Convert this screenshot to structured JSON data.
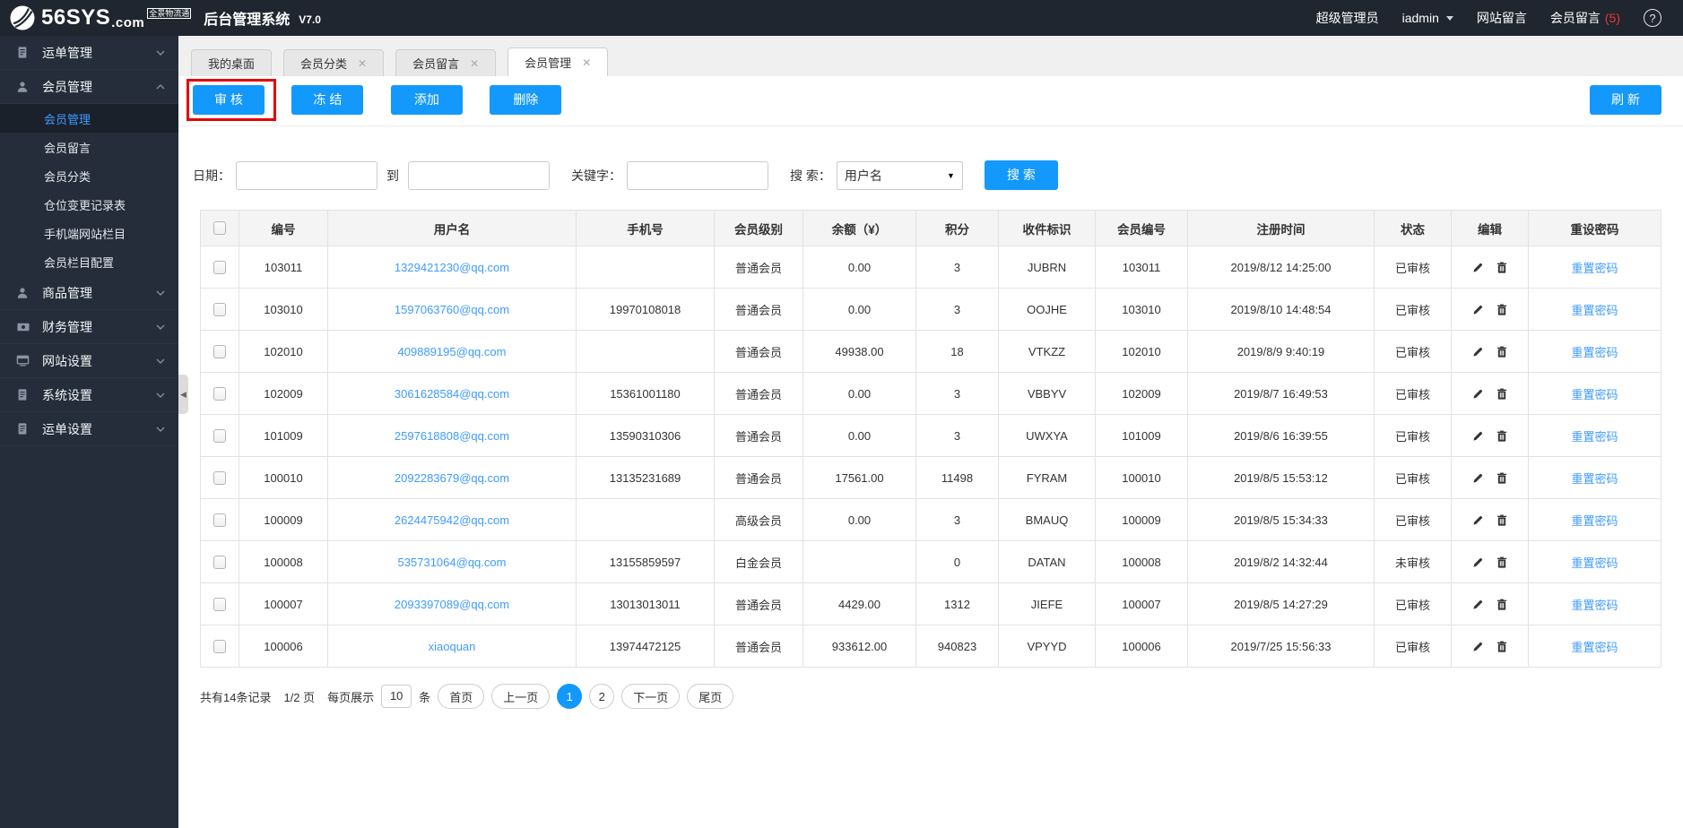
{
  "app": {
    "brand": "56SYS",
    "brand_suffix": ".com",
    "brand_tagline": "全景物流通",
    "title": "后台管理系统",
    "version": "V7.0",
    "topbar": {
      "role": "超级管理员",
      "username": "iadmin",
      "site_messages": "网站留言",
      "member_messages": "会员留言",
      "member_messages_count": "(5)",
      "help": "?"
    }
  },
  "sidebar": {
    "items": [
      {
        "label": "运单管理",
        "icon": "waybill-icon",
        "state": "collapsed"
      },
      {
        "label": "会员管理",
        "icon": "member-icon",
        "state": "expanded",
        "children": [
          {
            "label": "会员管理",
            "active": true
          },
          {
            "label": "会员留言",
            "active": false
          },
          {
            "label": "会员分类",
            "active": false
          },
          {
            "label": "仓位变更记录表",
            "active": false
          },
          {
            "label": "手机端网站栏目",
            "active": false
          },
          {
            "label": "会员栏目配置",
            "active": false
          }
        ]
      },
      {
        "label": "商品管理",
        "icon": "goods-icon",
        "state": "collapsed"
      },
      {
        "label": "财务管理",
        "icon": "finance-icon",
        "state": "collapsed"
      },
      {
        "label": "网站设置",
        "icon": "website-icon",
        "state": "collapsed"
      },
      {
        "label": "系统设置",
        "icon": "system-icon",
        "state": "collapsed"
      },
      {
        "label": "运单设置",
        "icon": "waybill-settings-icon",
        "state": "collapsed"
      }
    ]
  },
  "tabs": [
    {
      "label": "我的桌面",
      "closable": false,
      "active": false
    },
    {
      "label": "会员分类",
      "closable": true,
      "active": false
    },
    {
      "label": "会员留言",
      "closable": true,
      "active": false
    },
    {
      "label": "会员管理",
      "closable": true,
      "active": true
    }
  ],
  "toolbar": {
    "audit": "审 核",
    "freeze": "冻 结",
    "add": "添加",
    "remove": "删除",
    "refresh": "刷 新"
  },
  "filters": {
    "date_label": "日期：",
    "to_label": "到",
    "keyword_label": "关键字：",
    "search_by_label": "搜 索：",
    "search_type_selected": "用户名",
    "search_button": "搜 索"
  },
  "table": {
    "headers": [
      "编号",
      "用户名",
      "手机号",
      "会员级别",
      "余额（¥）",
      "积分",
      "收件标识",
      "会员编号",
      "注册时间",
      "状态",
      "编辑",
      "重设密码"
    ],
    "reset_label": "重置密码",
    "rows": [
      {
        "id": "103011",
        "username": "1329421230@qq.com",
        "phone": "",
        "level": "普通会员",
        "balance": "0.00",
        "points": "3",
        "code": "JUBRN",
        "member_id": "103011",
        "reg_time": "2019/8/12 14:25:00",
        "status": "已审核"
      },
      {
        "id": "103010",
        "username": "1597063760@qq.com",
        "phone": "19970108018",
        "level": "普通会员",
        "balance": "0.00",
        "points": "3",
        "code": "OOJHE",
        "member_id": "103010",
        "reg_time": "2019/8/10 14:48:54",
        "status": "已审核"
      },
      {
        "id": "102010",
        "username": "409889195@qq.com",
        "phone": "",
        "level": "普通会员",
        "balance": "49938.00",
        "points": "18",
        "code": "VTKZZ",
        "member_id": "102010",
        "reg_time": "2019/8/9 9:40:19",
        "status": "已审核"
      },
      {
        "id": "102009",
        "username": "3061628584@qq.com",
        "phone": "15361001180",
        "level": "普通会员",
        "balance": "0.00",
        "points": "3",
        "code": "VBBYV",
        "member_id": "102009",
        "reg_time": "2019/8/7 16:49:53",
        "status": "已审核"
      },
      {
        "id": "101009",
        "username": "2597618808@qq.com",
        "phone": "13590310306",
        "level": "普通会员",
        "balance": "0.00",
        "points": "3",
        "code": "UWXYA",
        "member_id": "101009",
        "reg_time": "2019/8/6 16:39:55",
        "status": "已审核"
      },
      {
        "id": "100010",
        "username": "2092283679@qq.com",
        "phone": "13135231689",
        "level": "普通会员",
        "balance": "17561.00",
        "points": "11498",
        "code": "FYRAM",
        "member_id": "100010",
        "reg_time": "2019/8/5 15:53:12",
        "status": "已审核"
      },
      {
        "id": "100009",
        "username": "2624475942@qq.com",
        "phone": "",
        "level": "高级会员",
        "balance": "0.00",
        "points": "3",
        "code": "BMAUQ",
        "member_id": "100009",
        "reg_time": "2019/8/5 15:34:33",
        "status": "已审核"
      },
      {
        "id": "100008",
        "username": "535731064@qq.com",
        "phone": "13155859597",
        "level": "白金会员",
        "balance": "",
        "points": "0",
        "code": "DATAN",
        "member_id": "100008",
        "reg_time": "2019/8/2 14:32:44",
        "status": "未审核"
      },
      {
        "id": "100007",
        "username": "2093397089@qq.com",
        "phone": "13013013011",
        "level": "普通会员",
        "balance": "4429.00",
        "points": "1312",
        "code": "JIEFE",
        "member_id": "100007",
        "reg_time": "2019/8/5 14:27:29",
        "status": "已审核"
      },
      {
        "id": "100006",
        "username": "xiaoquan",
        "phone": "13974472125",
        "level": "普通会员",
        "balance": "933612.00",
        "points": "940823",
        "code": "VPYYD",
        "member_id": "100006",
        "reg_time": "2019/7/25 15:56:33",
        "status": "已审核"
      }
    ]
  },
  "pagination": {
    "total_text": "共有14条记录",
    "page_text": "1/2 页",
    "per_page_prefix": "每页展示",
    "per_page_value": "10",
    "per_page_suffix": "条",
    "first": "首页",
    "prev": "上一页",
    "pages": [
      "1",
      "2"
    ],
    "active_page": "1",
    "next": "下一页",
    "last": "尾页"
  },
  "colors": {
    "accent_blue": "#1398fc",
    "link_blue": "#3e9bff",
    "sidebar_dark": "#252d3a",
    "topbar_dark": "#20262f",
    "highlight_red": "#e60000",
    "count_red": "#e33333"
  }
}
